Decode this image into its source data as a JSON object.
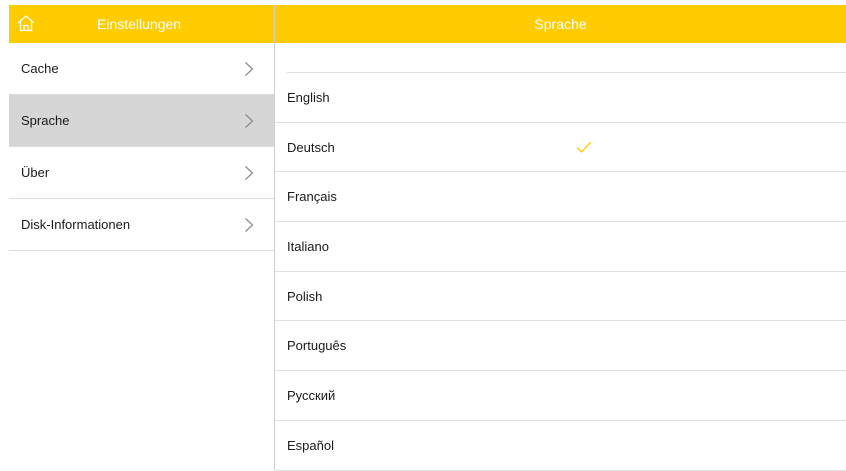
{
  "sidebar": {
    "title": "Einstellungen",
    "home_icon": "home-icon",
    "items": [
      {
        "label": "Cache",
        "selected": false
      },
      {
        "label": "Sprache",
        "selected": true
      },
      {
        "label": "Über",
        "selected": false
      },
      {
        "label": "Disk-Informationen",
        "selected": false
      }
    ]
  },
  "content": {
    "title": "Sprache",
    "languages": [
      {
        "label": "English",
        "checked": false
      },
      {
        "label": "Deutsch",
        "checked": true
      },
      {
        "label": "Français",
        "checked": false
      },
      {
        "label": "Italiano",
        "checked": false
      },
      {
        "label": "Polish",
        "checked": false
      },
      {
        "label": "Português",
        "checked": false
      },
      {
        "label": "Русский",
        "checked": false
      },
      {
        "label": "Español",
        "checked": false
      }
    ]
  },
  "colors": {
    "accent": "#ffcc00",
    "selected_row": "#d6d6d6",
    "checkmark": "#ffcc00"
  }
}
